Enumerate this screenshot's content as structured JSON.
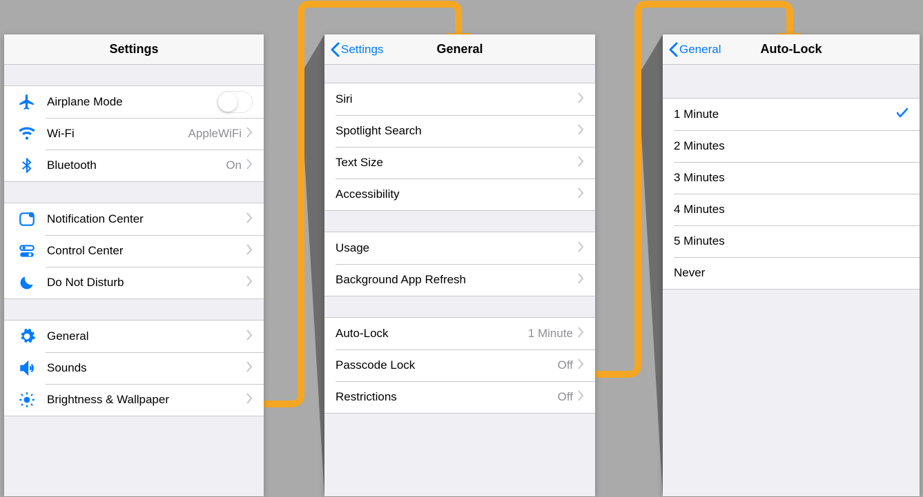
{
  "settings": {
    "title": "Settings",
    "g1": [
      {
        "icon": "airplane",
        "label": "Airplane Mode",
        "toggle": true
      },
      {
        "icon": "wifi",
        "label": "Wi-Fi",
        "value": "AppleWiFi",
        "disclosure": true
      },
      {
        "icon": "bt",
        "label": "Bluetooth",
        "value": "On",
        "disclosure": true
      }
    ],
    "g2": [
      {
        "icon": "notif",
        "label": "Notification Center",
        "disclosure": true
      },
      {
        "icon": "cc",
        "label": "Control Center",
        "disclosure": true
      },
      {
        "icon": "moon",
        "label": "Do Not Disturb",
        "disclosure": true
      }
    ],
    "g3": [
      {
        "icon": "gear",
        "label": "General",
        "disclosure": true
      },
      {
        "icon": "sound",
        "label": "Sounds",
        "disclosure": true
      },
      {
        "icon": "bright",
        "label": "Brightness & Wallpaper",
        "disclosure": true
      }
    ]
  },
  "general": {
    "back": "Settings",
    "title": "General",
    "g1": [
      {
        "label": "Siri",
        "disclosure": true
      },
      {
        "label": "Spotlight Search",
        "disclosure": true
      },
      {
        "label": "Text Size",
        "disclosure": true
      },
      {
        "label": "Accessibility",
        "disclosure": true
      }
    ],
    "g2": [
      {
        "label": "Usage",
        "disclosure": true
      },
      {
        "label": "Background App Refresh",
        "disclosure": true
      }
    ],
    "g3": [
      {
        "label": "Auto-Lock",
        "value": "1 Minute",
        "disclosure": true
      },
      {
        "label": "Passcode Lock",
        "value": "Off",
        "disclosure": true
      },
      {
        "label": "Restrictions",
        "value": "Off",
        "disclosure": true
      }
    ]
  },
  "autolock": {
    "back": "General",
    "title": "Auto-Lock",
    "options": [
      {
        "label": "1 Minute",
        "checked": true
      },
      {
        "label": "2 Minutes",
        "checked": false
      },
      {
        "label": "3 Minutes",
        "checked": false
      },
      {
        "label": "4 Minutes",
        "checked": false
      },
      {
        "label": "5 Minutes",
        "checked": false
      },
      {
        "label": "Never",
        "checked": false
      }
    ]
  }
}
